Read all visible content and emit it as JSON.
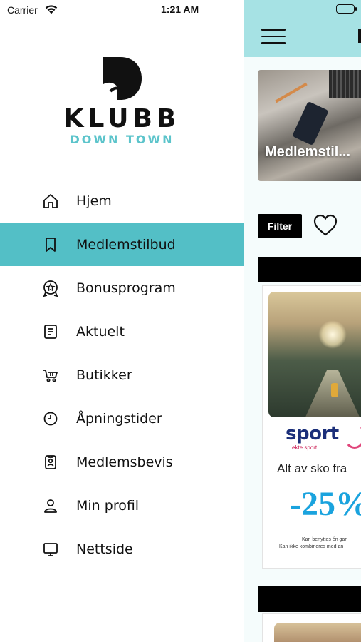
{
  "status_bar": {
    "carrier": "Carrier",
    "time": "1:21 AM",
    "battery_level": 1.0
  },
  "drawer": {
    "logo": {
      "mark": "D",
      "title": "KLUBB",
      "subtitle": "DOWN TOWN",
      "accent_color": "#5cc4cb"
    },
    "active_index": 1,
    "active_color": "#53bfc6",
    "items": [
      {
        "label": "Hjem",
        "icon": "home-icon"
      },
      {
        "label": "Medlemstilbud",
        "icon": "bookmark-icon"
      },
      {
        "label": "Bonusprogram",
        "icon": "award-icon"
      },
      {
        "label": "Aktuelt",
        "icon": "news-icon"
      },
      {
        "label": "Butikker",
        "icon": "cart-icon"
      },
      {
        "label": "Åpningstider",
        "icon": "clock-icon"
      },
      {
        "label": "Medlemsbevis",
        "icon": "member-card-icon"
      },
      {
        "label": "Min profil",
        "icon": "user-icon"
      },
      {
        "label": "Nettside",
        "icon": "monitor-icon"
      }
    ]
  },
  "main": {
    "header_color": "#a6e2e4",
    "hero_title": "Medlemstil...",
    "filter_label": "Filter",
    "offer_card": {
      "brand": "sport",
      "brand_tagline": "ekte sport.",
      "text": "Alt av sko fra",
      "discount": "-25%",
      "fine_print_1": "Kan benyttes én gan",
      "fine_print_2": "Kan ikke kombineres med an"
    }
  }
}
